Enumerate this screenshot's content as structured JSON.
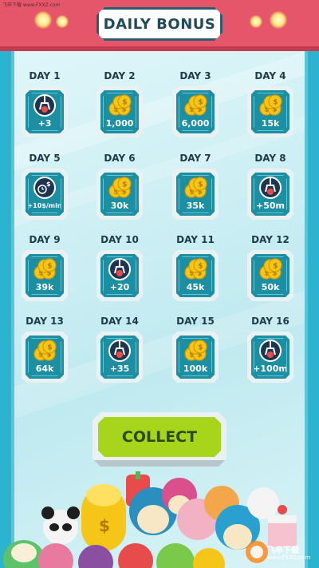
{
  "header": {
    "title": "DAILY BONUS",
    "watermark_top": "飞卒下载 www.FXXZ.com"
  },
  "days": [
    {
      "label": "DAY 1",
      "value": "+3",
      "icon": "claw-icon"
    },
    {
      "label": "DAY 2",
      "value": "1,000",
      "icon": "coins-icon"
    },
    {
      "label": "DAY 3",
      "value": "6,000",
      "icon": "coins-icon"
    },
    {
      "label": "DAY 4",
      "value": "15k",
      "icon": "coins-icon"
    },
    {
      "label": "DAY 5",
      "value": "+10$/min",
      "icon": "clock-money-icon"
    },
    {
      "label": "DAY 6",
      "value": "30k",
      "icon": "coins-icon"
    },
    {
      "label": "DAY 7",
      "value": "35k",
      "icon": "coins-icon"
    },
    {
      "label": "DAY 8",
      "value": "+50m",
      "icon": "claw-icon"
    },
    {
      "label": "DAY 9",
      "value": "39k",
      "icon": "coins-icon"
    },
    {
      "label": "DAY 10",
      "value": "+20",
      "icon": "claw-icon"
    },
    {
      "label": "DAY 11",
      "value": "45k",
      "icon": "coins-icon"
    },
    {
      "label": "DAY 12",
      "value": "50k",
      "icon": "coins-icon"
    },
    {
      "label": "DAY 13",
      "value": "64k",
      "icon": "coins-icon"
    },
    {
      "label": "DAY 14",
      "value": "+35",
      "icon": "claw-icon"
    },
    {
      "label": "DAY 15",
      "value": "100k",
      "icon": "coins-icon"
    },
    {
      "label": "DAY 16",
      "value": "+100m",
      "icon": "claw-icon"
    }
  ],
  "collect_button": {
    "label": "COLLECT"
  },
  "footer_watermark": {
    "name": "飞卒下载",
    "url": "www.FXXZ.com"
  },
  "colors": {
    "header": "#e5566a",
    "tile": "#1c8fa3",
    "collect": "#a6d51c",
    "coin": "#f5c518"
  }
}
